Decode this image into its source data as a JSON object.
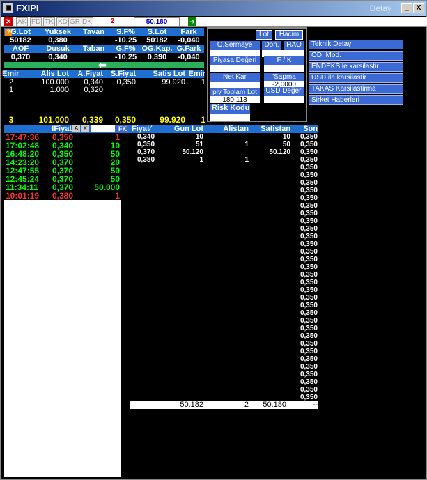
{
  "window": {
    "title": "FXIPI",
    "detail": "Detay",
    "minimize": "_",
    "close": "X"
  },
  "toolbar": {
    "tabs": [
      "AK",
      "FD",
      "TK",
      "KD",
      "GR",
      "DK"
    ],
    "count": "2",
    "price": "50.180"
  },
  "summary": {
    "h1": [
      "G.Lot",
      "Yuksek",
      "Tavan",
      "S.F%",
      "S.Lot",
      "Fark"
    ],
    "r1": [
      "50182",
      "0,380",
      "",
      "-10,25",
      "50182",
      "-0,040"
    ],
    "h2": [
      "AOF",
      "Dusuk",
      "Taban",
      "G.F%",
      "OG.Kap.",
      "G.Fark"
    ],
    "r2": [
      "0,370",
      "0,340",
      "",
      "-10,25",
      "0,390",
      "-0,040"
    ]
  },
  "depth": {
    "headers": [
      "Emir",
      "Alis Lot",
      "A.Fiyat",
      "S.Fiyat",
      "Satis Lot",
      "Emir"
    ],
    "rows": [
      [
        "2",
        "100.000",
        "0,340",
        "0,350",
        "99.920",
        "1"
      ],
      [
        "1",
        "1.000",
        "0,320",
        "",
        "",
        ""
      ]
    ],
    "total": [
      "3",
      "101.000",
      "0,339",
      "0,350",
      "99.920",
      "1"
    ]
  },
  "panel": {
    "lot": "Lot",
    "hacim": "Hacim",
    "osermaye": "O.Sermaye",
    "don": "Dön.",
    "hao": "HAO",
    "piyasa": "Piyasa Değeri",
    "fk": "F / K",
    "netkar": "Net Kar",
    "sapma": "'Sapma",
    "sapma_val": "-2,0000",
    "piy": "piy.Toplam Lot",
    "piy_val": "180.113",
    "usd": "USD Değeri",
    "risk": "Risk Kodu"
  },
  "menu": [
    "Teknik Detay",
    "OD. Mod.",
    "ENDEKS le karsilastir",
    "USD ile karsilastir",
    "TAKAS Karsilastirma",
    "Sirket Haberleri"
  ],
  "trades": {
    "headers": {
      "fiyat": "IFiyat",
      "a": "A",
      "k": "K",
      "fk": "FK"
    },
    "rows": [
      {
        "t": "17:47:36",
        "p": "0,350",
        "q": "1",
        "c": "r"
      },
      {
        "t": "17:02:48",
        "p": "0,340",
        "q": "10",
        "c": "g"
      },
      {
        "t": "16:48:20",
        "p": "0,350",
        "q": "50",
        "c": "g"
      },
      {
        "t": "14:23:20",
        "p": "0,370",
        "q": "20",
        "c": "g"
      },
      {
        "t": "12:47:55",
        "p": "0,370",
        "q": "50",
        "c": "g"
      },
      {
        "t": "12:45:24",
        "p": "0,370",
        "q": "50",
        "c": "g"
      },
      {
        "t": "11:34:11",
        "p": "0,370",
        "q": "50.000",
        "c": "g"
      },
      {
        "t": "10:01:19",
        "p": "0,380",
        "q": "1",
        "c": "r"
      }
    ]
  },
  "volume": {
    "headers": [
      "Fiyat∕",
      "Gun Lot",
      "Alistan",
      "Satistan",
      "Son"
    ],
    "rows": [
      [
        "0,340",
        "10",
        "",
        "10"
      ],
      [
        "0,350",
        "51",
        "1",
        "50"
      ],
      [
        "0,370",
        "50.120",
        "",
        "50.120"
      ],
      [
        "0,380",
        "1",
        "1",
        ""
      ]
    ],
    "son": "0,350",
    "total": [
      "",
      "50.182",
      "2",
      "50.180",
      "--"
    ]
  }
}
